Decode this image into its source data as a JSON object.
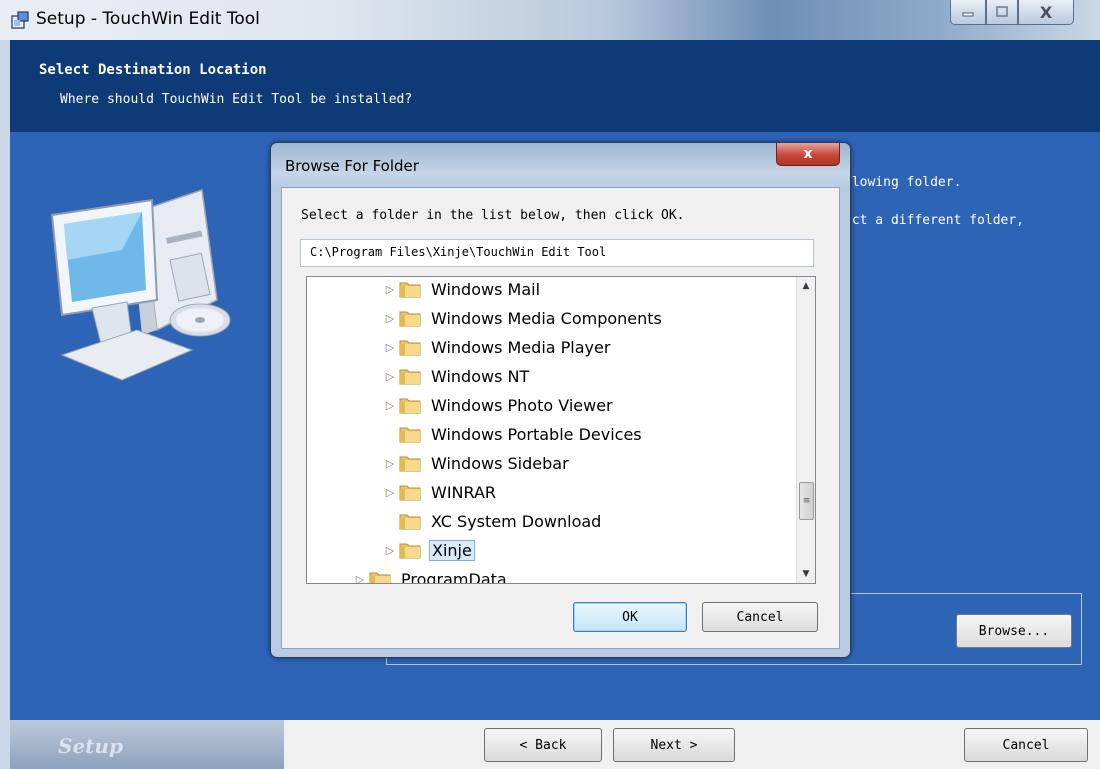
{
  "window": {
    "title": "Setup - TouchWin Edit Tool",
    "close_glyph": "X"
  },
  "header": {
    "title": "Select Destination Location",
    "subtitle": "Where should TouchWin Edit Tool be installed?"
  },
  "body": {
    "line1_partial": "llowing folder.",
    "line2_partial": "ect a different folder,",
    "browse_label": "Browse..."
  },
  "footer": {
    "brand": "Setup",
    "back_label": "< Back",
    "next_label": "Next >",
    "cancel_label": "Cancel"
  },
  "dialog": {
    "title": "Browse For Folder",
    "close_glyph": "x",
    "prompt": "Select a folder in the list below, then click OK.",
    "path": "C:\\Program Files\\Xinje\\TouchWin Edit Tool",
    "ok_label": "OK",
    "cancel_label": "Cancel",
    "tree": [
      {
        "label": "Windows Mail",
        "expandable": true,
        "selected": false
      },
      {
        "label": "Windows Media Components",
        "expandable": true,
        "selected": false
      },
      {
        "label": "Windows Media Player",
        "expandable": true,
        "selected": false
      },
      {
        "label": "Windows NT",
        "expandable": true,
        "selected": false
      },
      {
        "label": "Windows Photo Viewer",
        "expandable": true,
        "selected": false
      },
      {
        "label": "Windows Portable Devices",
        "expandable": false,
        "selected": false
      },
      {
        "label": "Windows Sidebar",
        "expandable": true,
        "selected": false
      },
      {
        "label": "WINRAR",
        "expandable": true,
        "selected": false
      },
      {
        "label": "XC System Download",
        "expandable": false,
        "selected": false
      },
      {
        "label": "Xinje",
        "expandable": true,
        "selected": true
      },
      {
        "label": "ProgramData",
        "expandable": true,
        "selected": false
      }
    ]
  },
  "icons": {
    "setup_icon": "setup-box-icon",
    "folder_icon": "folder-icon",
    "computer_icon": "computer-disc-icon"
  },
  "colors": {
    "header_bg": "#0f3a78",
    "body_bg": "#2e64b6",
    "folder": "#e9c46a"
  }
}
